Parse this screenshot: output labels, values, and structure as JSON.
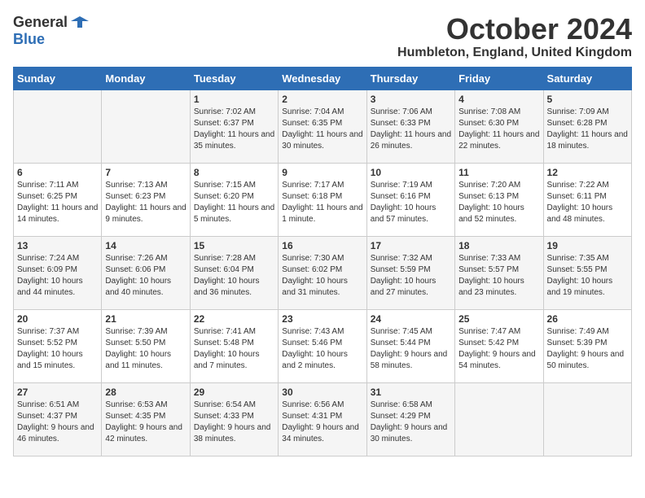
{
  "logo": {
    "general": "General",
    "blue": "Blue"
  },
  "title": "October 2024",
  "location": "Humbleton, England, United Kingdom",
  "days_header": [
    "Sunday",
    "Monday",
    "Tuesday",
    "Wednesday",
    "Thursday",
    "Friday",
    "Saturday"
  ],
  "weeks": [
    [
      {
        "num": "",
        "sunrise": "",
        "sunset": "",
        "daylight": ""
      },
      {
        "num": "",
        "sunrise": "",
        "sunset": "",
        "daylight": ""
      },
      {
        "num": "1",
        "sunrise": "Sunrise: 7:02 AM",
        "sunset": "Sunset: 6:37 PM",
        "daylight": "Daylight: 11 hours and 35 minutes."
      },
      {
        "num": "2",
        "sunrise": "Sunrise: 7:04 AM",
        "sunset": "Sunset: 6:35 PM",
        "daylight": "Daylight: 11 hours and 30 minutes."
      },
      {
        "num": "3",
        "sunrise": "Sunrise: 7:06 AM",
        "sunset": "Sunset: 6:33 PM",
        "daylight": "Daylight: 11 hours and 26 minutes."
      },
      {
        "num": "4",
        "sunrise": "Sunrise: 7:08 AM",
        "sunset": "Sunset: 6:30 PM",
        "daylight": "Daylight: 11 hours and 22 minutes."
      },
      {
        "num": "5",
        "sunrise": "Sunrise: 7:09 AM",
        "sunset": "Sunset: 6:28 PM",
        "daylight": "Daylight: 11 hours and 18 minutes."
      }
    ],
    [
      {
        "num": "6",
        "sunrise": "Sunrise: 7:11 AM",
        "sunset": "Sunset: 6:25 PM",
        "daylight": "Daylight: 11 hours and 14 minutes."
      },
      {
        "num": "7",
        "sunrise": "Sunrise: 7:13 AM",
        "sunset": "Sunset: 6:23 PM",
        "daylight": "Daylight: 11 hours and 9 minutes."
      },
      {
        "num": "8",
        "sunrise": "Sunrise: 7:15 AM",
        "sunset": "Sunset: 6:20 PM",
        "daylight": "Daylight: 11 hours and 5 minutes."
      },
      {
        "num": "9",
        "sunrise": "Sunrise: 7:17 AM",
        "sunset": "Sunset: 6:18 PM",
        "daylight": "Daylight: 11 hours and 1 minute."
      },
      {
        "num": "10",
        "sunrise": "Sunrise: 7:19 AM",
        "sunset": "Sunset: 6:16 PM",
        "daylight": "Daylight: 10 hours and 57 minutes."
      },
      {
        "num": "11",
        "sunrise": "Sunrise: 7:20 AM",
        "sunset": "Sunset: 6:13 PM",
        "daylight": "Daylight: 10 hours and 52 minutes."
      },
      {
        "num": "12",
        "sunrise": "Sunrise: 7:22 AM",
        "sunset": "Sunset: 6:11 PM",
        "daylight": "Daylight: 10 hours and 48 minutes."
      }
    ],
    [
      {
        "num": "13",
        "sunrise": "Sunrise: 7:24 AM",
        "sunset": "Sunset: 6:09 PM",
        "daylight": "Daylight: 10 hours and 44 minutes."
      },
      {
        "num": "14",
        "sunrise": "Sunrise: 7:26 AM",
        "sunset": "Sunset: 6:06 PM",
        "daylight": "Daylight: 10 hours and 40 minutes."
      },
      {
        "num": "15",
        "sunrise": "Sunrise: 7:28 AM",
        "sunset": "Sunset: 6:04 PM",
        "daylight": "Daylight: 10 hours and 36 minutes."
      },
      {
        "num": "16",
        "sunrise": "Sunrise: 7:30 AM",
        "sunset": "Sunset: 6:02 PM",
        "daylight": "Daylight: 10 hours and 31 minutes."
      },
      {
        "num": "17",
        "sunrise": "Sunrise: 7:32 AM",
        "sunset": "Sunset: 5:59 PM",
        "daylight": "Daylight: 10 hours and 27 minutes."
      },
      {
        "num": "18",
        "sunrise": "Sunrise: 7:33 AM",
        "sunset": "Sunset: 5:57 PM",
        "daylight": "Daylight: 10 hours and 23 minutes."
      },
      {
        "num": "19",
        "sunrise": "Sunrise: 7:35 AM",
        "sunset": "Sunset: 5:55 PM",
        "daylight": "Daylight: 10 hours and 19 minutes."
      }
    ],
    [
      {
        "num": "20",
        "sunrise": "Sunrise: 7:37 AM",
        "sunset": "Sunset: 5:52 PM",
        "daylight": "Daylight: 10 hours and 15 minutes."
      },
      {
        "num": "21",
        "sunrise": "Sunrise: 7:39 AM",
        "sunset": "Sunset: 5:50 PM",
        "daylight": "Daylight: 10 hours and 11 minutes."
      },
      {
        "num": "22",
        "sunrise": "Sunrise: 7:41 AM",
        "sunset": "Sunset: 5:48 PM",
        "daylight": "Daylight: 10 hours and 7 minutes."
      },
      {
        "num": "23",
        "sunrise": "Sunrise: 7:43 AM",
        "sunset": "Sunset: 5:46 PM",
        "daylight": "Daylight: 10 hours and 2 minutes."
      },
      {
        "num": "24",
        "sunrise": "Sunrise: 7:45 AM",
        "sunset": "Sunset: 5:44 PM",
        "daylight": "Daylight: 9 hours and 58 minutes."
      },
      {
        "num": "25",
        "sunrise": "Sunrise: 7:47 AM",
        "sunset": "Sunset: 5:42 PM",
        "daylight": "Daylight: 9 hours and 54 minutes."
      },
      {
        "num": "26",
        "sunrise": "Sunrise: 7:49 AM",
        "sunset": "Sunset: 5:39 PM",
        "daylight": "Daylight: 9 hours and 50 minutes."
      }
    ],
    [
      {
        "num": "27",
        "sunrise": "Sunrise: 6:51 AM",
        "sunset": "Sunset: 4:37 PM",
        "daylight": "Daylight: 9 hours and 46 minutes."
      },
      {
        "num": "28",
        "sunrise": "Sunrise: 6:53 AM",
        "sunset": "Sunset: 4:35 PM",
        "daylight": "Daylight: 9 hours and 42 minutes."
      },
      {
        "num": "29",
        "sunrise": "Sunrise: 6:54 AM",
        "sunset": "Sunset: 4:33 PM",
        "daylight": "Daylight: 9 hours and 38 minutes."
      },
      {
        "num": "30",
        "sunrise": "Sunrise: 6:56 AM",
        "sunset": "Sunset: 4:31 PM",
        "daylight": "Daylight: 9 hours and 34 minutes."
      },
      {
        "num": "31",
        "sunrise": "Sunrise: 6:58 AM",
        "sunset": "Sunset: 4:29 PM",
        "daylight": "Daylight: 9 hours and 30 minutes."
      },
      {
        "num": "",
        "sunrise": "",
        "sunset": "",
        "daylight": ""
      },
      {
        "num": "",
        "sunrise": "",
        "sunset": "",
        "daylight": ""
      }
    ]
  ]
}
